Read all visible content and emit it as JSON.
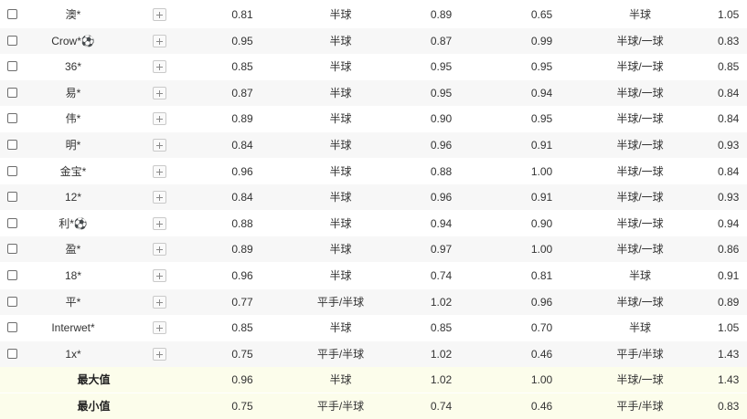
{
  "rows": [
    {
      "name": "澳*",
      "a": "0.81",
      "h1": "半球",
      "b": "0.89",
      "c": "0.65",
      "h2": "半球",
      "d": "1.05"
    },
    {
      "name": "Crow*⚽",
      "a": "0.95",
      "h1": "半球",
      "b": "0.87",
      "c": "0.99",
      "h2": "半球/一球",
      "d": "0.83"
    },
    {
      "name": "36*",
      "a": "0.85",
      "h1": "半球",
      "b": "0.95",
      "c": "0.95",
      "h2": "半球/一球",
      "d": "0.85"
    },
    {
      "name": "易*",
      "a": "0.87",
      "h1": "半球",
      "b": "0.95",
      "c": "0.94",
      "h2": "半球/一球",
      "d": "0.84"
    },
    {
      "name": "伟*",
      "a": "0.89",
      "h1": "半球",
      "b": "0.90",
      "c": "0.95",
      "h2": "半球/一球",
      "d": "0.84"
    },
    {
      "name": "明*",
      "a": "0.84",
      "h1": "半球",
      "b": "0.96",
      "c": "0.91",
      "h2": "半球/一球",
      "d": "0.93"
    },
    {
      "name": "金宝*",
      "a": "0.96",
      "h1": "半球",
      "b": "0.88",
      "c": "1.00",
      "h2": "半球/一球",
      "d": "0.84"
    },
    {
      "name": "12*",
      "a": "0.84",
      "h1": "半球",
      "b": "0.96",
      "c": "0.91",
      "h2": "半球/一球",
      "d": "0.93"
    },
    {
      "name": "利*⚽",
      "a": "0.88",
      "h1": "半球",
      "b": "0.94",
      "c": "0.90",
      "h2": "半球/一球",
      "d": "0.94"
    },
    {
      "name": "盈*",
      "a": "0.89",
      "h1": "半球",
      "b": "0.97",
      "c": "1.00",
      "h2": "半球/一球",
      "d": "0.86"
    },
    {
      "name": "18*",
      "a": "0.96",
      "h1": "半球",
      "b": "0.74",
      "c": "0.81",
      "h2": "半球",
      "d": "0.91"
    },
    {
      "name": "平*",
      "a": "0.77",
      "h1": "平手/半球",
      "b": "1.02",
      "c": "0.96",
      "h2": "半球/一球",
      "d": "0.89"
    },
    {
      "name": "Interwet*",
      "a": "0.85",
      "h1": "半球",
      "b": "0.85",
      "c": "0.70",
      "h2": "半球",
      "d": "1.05"
    },
    {
      "name": "1x*",
      "a": "0.75",
      "h1": "平手/半球",
      "b": "1.02",
      "c": "0.46",
      "h2": "平手/半球",
      "d": "1.43"
    }
  ],
  "summary": [
    {
      "label": "最大值",
      "a": "0.96",
      "h1": "半球",
      "b": "1.02",
      "c": "1.00",
      "h2": "半球/一球",
      "d": "1.43"
    },
    {
      "label": "最小值",
      "a": "0.75",
      "h1": "平手/半球",
      "b": "0.74",
      "c": "0.46",
      "h2": "平手/半球",
      "d": "0.83"
    }
  ]
}
